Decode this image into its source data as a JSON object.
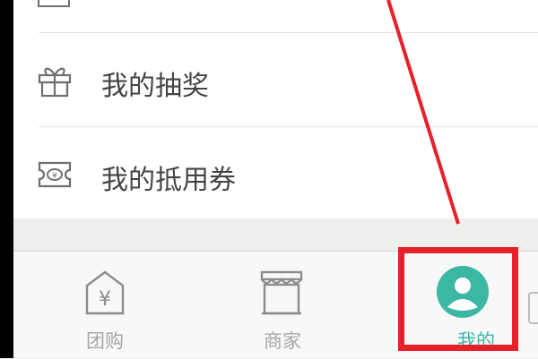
{
  "menu": {
    "items": [
      {
        "label": "我的抽奖",
        "icon": "gift-icon"
      },
      {
        "label": "我的抵用券",
        "icon": "voucher-icon"
      }
    ]
  },
  "tabbar": {
    "tabs": [
      {
        "label": "团购",
        "icon": "yen-tag-icon",
        "active": false
      },
      {
        "label": "商家",
        "icon": "storefront-icon",
        "active": false
      },
      {
        "label": "我的",
        "icon": "user-avatar-icon",
        "active": true
      }
    ]
  },
  "colors": {
    "accent": "#3bb7a3",
    "annotation": "#e8202a",
    "inactive": "#a6a6a6"
  }
}
